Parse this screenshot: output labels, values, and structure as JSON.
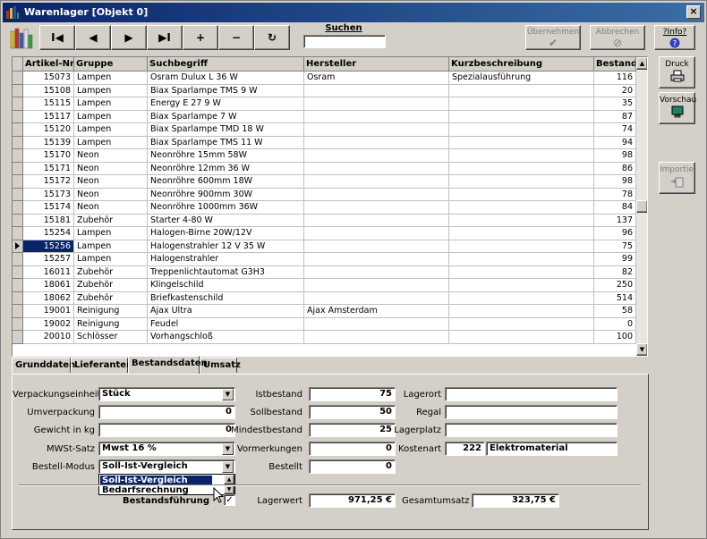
{
  "window": {
    "title": "Warenlager [Objekt 0]",
    "close": "×"
  },
  "toolbar": {
    "nav": [
      "I◀",
      "◀",
      "▶",
      "▶I",
      "+",
      "−",
      "↻"
    ],
    "search_label": "Suchen",
    "search_value": "",
    "apply_label": "Übernehmen",
    "cancel_label": "Abbrechen",
    "info_label": "?Info?"
  },
  "side": {
    "print_label": "Druck",
    "preview_label": "Vorschau",
    "import_label": "Importieren"
  },
  "table": {
    "columns": [
      "Artikel-Nr",
      "Gruppe",
      "Suchbegriff",
      "Hersteller",
      "Kurzbeschreibung",
      "Bestand"
    ],
    "rows": [
      [
        "15073",
        "Lampen",
        "Osram Dulux L 36 W",
        "Osram",
        "Spezialausführung",
        "116"
      ],
      [
        "15108",
        "Lampen",
        "Biax Sparlampe TMS 9 W",
        "",
        "",
        "20"
      ],
      [
        "15115",
        "Lampen",
        "Energy E 27 9 W",
        "",
        "",
        "35"
      ],
      [
        "15117",
        "Lampen",
        "Biax Sparlampe 7 W",
        "",
        "",
        "87"
      ],
      [
        "15120",
        "Lampen",
        "Biax Sparlampe TMD 18 W",
        "",
        "",
        "74"
      ],
      [
        "15139",
        "Lampen",
        "Biax Sparlampe TMS 11 W",
        "",
        "",
        "94"
      ],
      [
        "15170",
        "Neon",
        "Neonröhre 15mm  58W",
        "",
        "",
        "98"
      ],
      [
        "15171",
        "Neon",
        "Neonröhre 12mm 36 W",
        "",
        "",
        "86"
      ],
      [
        "15172",
        "Neon",
        "Neonröhre 600mm 18W",
        "",
        "",
        "98"
      ],
      [
        "15173",
        "Neon",
        "Neonröhre 900mm 30W",
        "",
        "",
        "78"
      ],
      [
        "15174",
        "Neon",
        "Neonröhre 1000mm 36W",
        "",
        "",
        "84"
      ],
      [
        "15181",
        "Zubehör",
        "Starter 4-80 W",
        "",
        "",
        "137"
      ],
      [
        "15254",
        "Lampen",
        "Halogen-Birne 20W/12V",
        "",
        "",
        "96"
      ],
      [
        "15256",
        "Lampen",
        "Halogenstrahler 12 V  35 W",
        "",
        "",
        "75"
      ],
      [
        "15257",
        "Lampen",
        "Halogenstrahler",
        "",
        "",
        "99"
      ],
      [
        "16011",
        "Zubehör",
        "Treppenlichtautomat G3H3",
        "",
        "",
        "82"
      ],
      [
        "18061",
        "Zubehör",
        "Klingelschild",
        "",
        "",
        "250"
      ],
      [
        "18062",
        "Zubehör",
        "Briefkastenschild",
        "",
        "",
        "514"
      ],
      [
        "19001",
        "Reinigung",
        "Ajax Ultra",
        "Ajax Amsterdam",
        "",
        "58"
      ],
      [
        "19002",
        "Reinigung",
        "Feudel",
        "",
        "",
        "0"
      ],
      [
        "20010",
        "Schlösser",
        "Vorhangschloß",
        "",
        "",
        "100"
      ]
    ],
    "selected_index": 13
  },
  "tabs": [
    "Grunddaten",
    "Lieferanten",
    "Bestandsdaten",
    "Umsatz"
  ],
  "active_tab": 2,
  "form": {
    "verpackungseinheit_label": "Verpackungseinheit",
    "verpackungseinheit": "Stück",
    "umverpackung_label": "Umverpackung",
    "umverpackung": "0",
    "gewicht_label": "Gewicht in kg",
    "gewicht": "0",
    "mwst_label": "MWSt-Satz",
    "mwst": "Mwst 16 %",
    "bestellmodus_label": "Bestell-Modus",
    "bestellmodus": "Soll-Ist-Vergleich",
    "dropdown_options": [
      "Soll-Ist-Vergleich",
      "Bedarfsrechnung"
    ],
    "istbestand_label": "Istbestand",
    "istbestand": "75",
    "sollbestand_label": "Sollbestand",
    "sollbestand": "50",
    "mindestbestand_label": "Mindestbestand",
    "mindestbestand": "25",
    "vormerkungen_label": "Vormerkungen",
    "vormerkungen": "0",
    "bestellt_label": "Bestellt",
    "bestellt": "0",
    "lagerort_label": "Lagerort",
    "lagerort": "",
    "regal_label": "Regal",
    "regal": "",
    "lagerplatz_label": "Lagerplatz",
    "lagerplatz": "",
    "kostenart_label": "Kostenart",
    "kostenart_nr": "222",
    "kostenart_name": "Elektromaterial",
    "bestandsfuehrung_label": "Bestandsführung",
    "bestandsfuehrung_checked": "✓",
    "lagerwert_label": "Lagerwert",
    "lagerwert": "971,25 €",
    "gesamtumsatz_label": "Gesamtumsatz",
    "gesamtumsatz": "323,75 €"
  },
  "colors": {
    "title_start": "#0a246a",
    "title_end": "#3a6ea5",
    "face": "#d4d0c8",
    "selection": "#0a246a"
  }
}
